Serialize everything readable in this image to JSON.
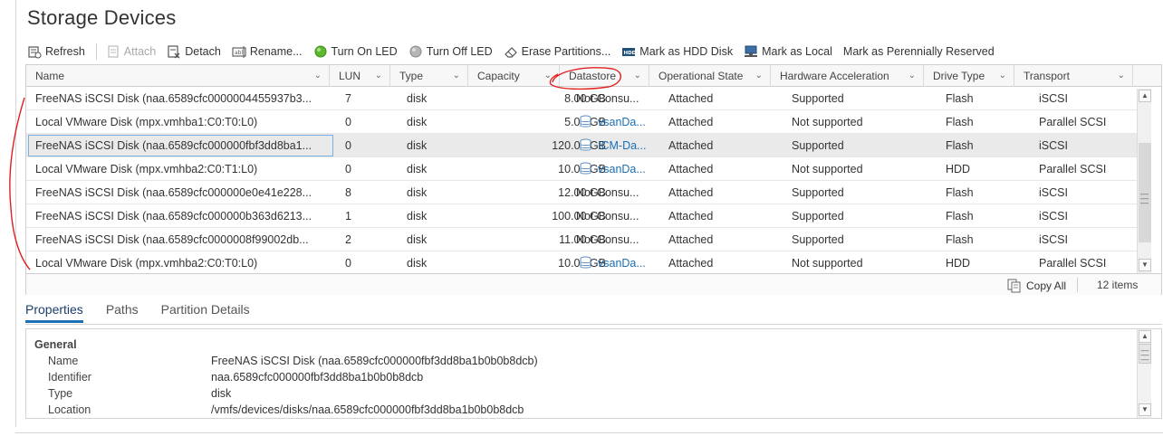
{
  "page": {
    "title": "Storage Devices"
  },
  "toolbar": {
    "refresh": "Refresh",
    "attach": "Attach",
    "detach": "Detach",
    "rename": "Rename...",
    "turn_on_led": "Turn On LED",
    "turn_off_led": "Turn Off LED",
    "erase_partitions": "Erase Partitions...",
    "mark_hdd": "Mark as HDD Disk",
    "mark_local": "Mark as Local",
    "mark_perennially": "Mark as Perennially Reserved"
  },
  "table": {
    "columns": [
      "Name",
      "LUN",
      "Type",
      "Capacity",
      "Datastore",
      "Operational State",
      "Hardware Acceleration",
      "Drive Type",
      "Transport"
    ],
    "rows": [
      {
        "name": "FreeNAS iSCSI Disk (naa.6589cfc0000004455937b3...",
        "lun": "7",
        "type": "disk",
        "capacity": "8.00 GB",
        "datastore": "Not Consu...",
        "ds_link": false,
        "state": "Attached",
        "hw": "Supported",
        "drive": "Flash",
        "transport": "iSCSI"
      },
      {
        "name": "Local VMware Disk (mpx.vmhba1:C0:T0:L0)",
        "lun": "0",
        "type": "disk",
        "capacity": "5.00 GB",
        "datastore": "vsanDa...",
        "ds_link": true,
        "state": "Attached",
        "hw": "Not supported",
        "drive": "Flash",
        "transport": "Parallel SCSI"
      },
      {
        "name": "FreeNAS iSCSI Disk (naa.6589cfc000000fbf3dd8ba1...",
        "lun": "0",
        "type": "disk",
        "capacity": "120.00 GB",
        "datastore": "ICM-Da...",
        "ds_link": true,
        "state": "Attached",
        "hw": "Supported",
        "drive": "Flash",
        "transport": "iSCSI",
        "selected": true
      },
      {
        "name": "Local VMware Disk (mpx.vmhba2:C0:T1:L0)",
        "lun": "0",
        "type": "disk",
        "capacity": "10.00 GB",
        "datastore": "vsanDa...",
        "ds_link": true,
        "state": "Attached",
        "hw": "Not supported",
        "drive": "HDD",
        "transport": "Parallel SCSI"
      },
      {
        "name": "FreeNAS iSCSI Disk (naa.6589cfc000000e0e41e228...",
        "lun": "8",
        "type": "disk",
        "capacity": "12.00 GB",
        "datastore": "Not Consu...",
        "ds_link": false,
        "state": "Attached",
        "hw": "Supported",
        "drive": "Flash",
        "transport": "iSCSI"
      },
      {
        "name": "FreeNAS iSCSI Disk (naa.6589cfc000000b363d6213...",
        "lun": "1",
        "type": "disk",
        "capacity": "100.00 GB",
        "datastore": "Not Consu...",
        "ds_link": false,
        "state": "Attached",
        "hw": "Supported",
        "drive": "Flash",
        "transport": "iSCSI"
      },
      {
        "name": "FreeNAS iSCSI Disk (naa.6589cfc0000008f99002db...",
        "lun": "2",
        "type": "disk",
        "capacity": "11.00 GB",
        "datastore": "Not Consu...",
        "ds_link": false,
        "state": "Attached",
        "hw": "Supported",
        "drive": "Flash",
        "transport": "iSCSI"
      },
      {
        "name": "Local VMware Disk (mpx.vmhba2:C0:T0:L0)",
        "lun": "0",
        "type": "disk",
        "capacity": "10.00 GB",
        "datastore": "vsanDa...",
        "ds_link": true,
        "state": "Attached",
        "hw": "Not supported",
        "drive": "HDD",
        "transport": "Parallel SCSI"
      }
    ]
  },
  "footer": {
    "copy_all": "Copy All",
    "item_count": "12 items"
  },
  "tabs": [
    "Properties",
    "Paths",
    "Partition Details"
  ],
  "properties": {
    "section": "General",
    "rows": [
      {
        "key": "Name",
        "value": "FreeNAS iSCSI Disk (naa.6589cfc000000fbf3dd8ba1b0b0b8dcb)"
      },
      {
        "key": "Identifier",
        "value": "naa.6589cfc000000fbf3dd8ba1b0b0b8dcb"
      },
      {
        "key": "Type",
        "value": "disk"
      },
      {
        "key": "Location",
        "value": "/vmfs/devices/disks/naa.6589cfc000000fbf3dd8ba1b0b0b8dcb"
      }
    ]
  },
  "colors": {
    "link": "#1a6fb5",
    "annotation": "#e02020",
    "selected_row": "#eaeaea",
    "led_on": "#5cb82e"
  }
}
